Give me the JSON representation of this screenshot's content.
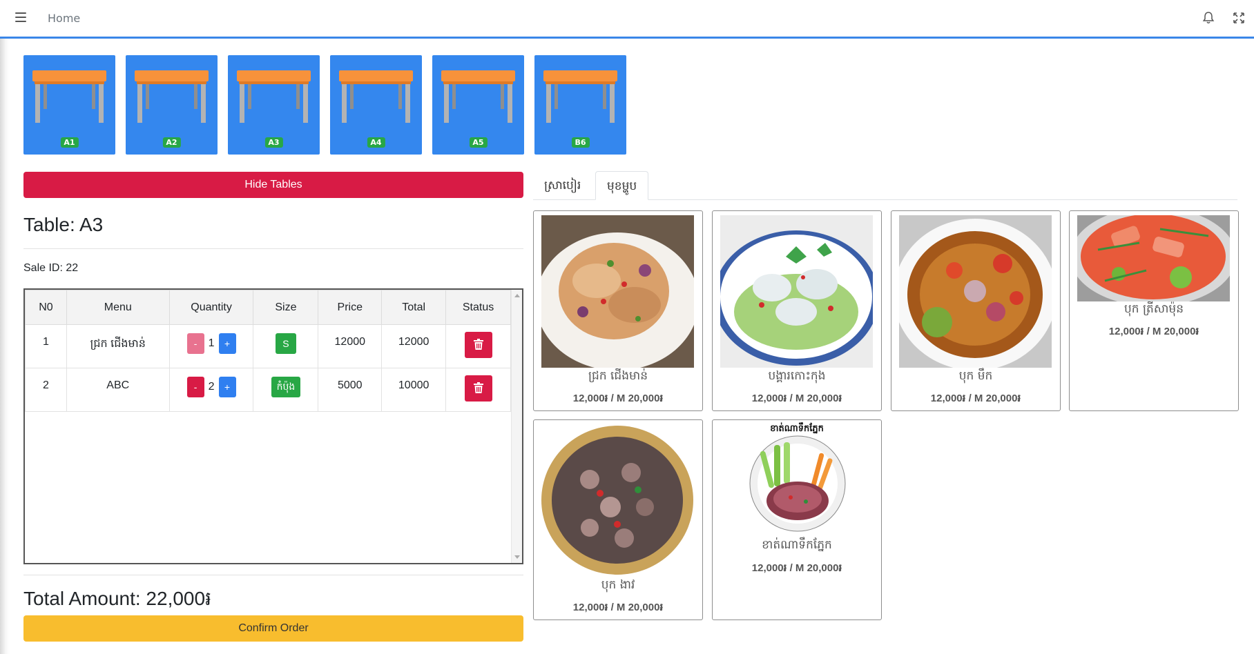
{
  "topbar": {
    "home_label": "Home"
  },
  "tables": [
    {
      "label": "A1"
    },
    {
      "label": "A2"
    },
    {
      "label": "A3"
    },
    {
      "label": "A4"
    },
    {
      "label": "A5"
    },
    {
      "label": "B6"
    }
  ],
  "order": {
    "hide_tables_label": "Hide Tables",
    "table_title": "Table: A3",
    "sale_id": "Sale ID: 22",
    "columns": [
      "N0",
      "Menu",
      "Quantity",
      "Size",
      "Price",
      "Total",
      "Status"
    ],
    "rows": [
      {
        "no": "1",
        "menu": "ជ្រក ជើងមាន់",
        "qty": "1",
        "size": "S",
        "price": "12000",
        "total": "12000"
      },
      {
        "no": "2",
        "menu": "ABC",
        "qty": "2",
        "size": "កំប៉ុង",
        "price": "5000",
        "total": "10000"
      }
    ],
    "minus_label": "-",
    "plus_label": "+",
    "total_amount": "Total Amount: 22,000៛",
    "confirm_label": "Confirm Order"
  },
  "tabs": [
    "ស្រាបៀរ",
    "មុខម្ហូប"
  ],
  "menu_items": [
    {
      "name": "ជ្រក ជើងមាន់",
      "price": "12,000៛ / M 20,000៛"
    },
    {
      "name": "បង្គារកោះកុង",
      "price": "12,000៛ / M 20,000៛"
    },
    {
      "name": "បុក មឹក",
      "price": "12,000៛ / M 20,000៛"
    },
    {
      "name": "បុក ត្រីសាម៉ុន",
      "price": "12,000៛ / M 20,000៛"
    },
    {
      "name": "បុក ងាវ",
      "price": "12,000៛ / M 20,000៛"
    },
    {
      "name": "ខាត់ណាទឹកភ្នែក",
      "price": "12,000៛ / M 20,000៛",
      "image_caption": "ខាត់ណាទឹកភ្នែក"
    }
  ],
  "colors": {
    "accent_blue": "#3487ee",
    "danger": "#d81b45",
    "success": "#28a745",
    "warning": "#f8bd2e"
  },
  "icons": [
    "menu-icon",
    "bell-icon",
    "fullscreen-icon",
    "table-icon",
    "trash-icon"
  ]
}
